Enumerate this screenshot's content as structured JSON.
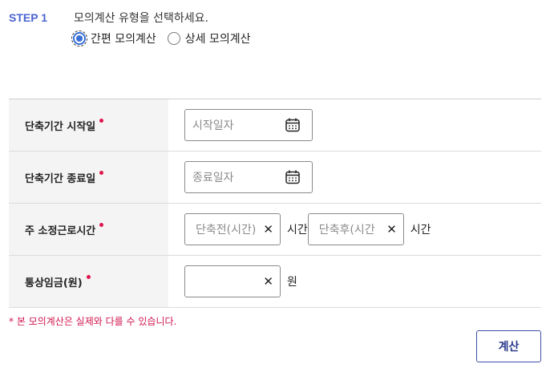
{
  "step": {
    "label": "STEP 1",
    "instruction": "모의계산 유형을 선택하세요."
  },
  "calc_type": {
    "options": [
      {
        "label": "간편 모의계산",
        "selected": true
      },
      {
        "label": "상세 모의계산",
        "selected": false
      }
    ]
  },
  "form": {
    "rows": [
      {
        "label": "단축기간 시작일",
        "required": true,
        "placeholder": "시작일자",
        "icon": "calendar-icon"
      },
      {
        "label": "단축기간 종료일",
        "required": true,
        "placeholder": "종료일자",
        "icon": "calendar-icon"
      },
      {
        "label": "주 소정근로시간",
        "required": true,
        "before_placeholder": "단축전(시간)",
        "before_unit": "시간",
        "after_placeholder": "단축후(시간",
        "after_unit": "시간"
      },
      {
        "label": "통상임금(원)",
        "required": true,
        "value": "",
        "unit": "원"
      }
    ]
  },
  "notice": "* 본 모의계산은 실제와 다를 수 있습니다.",
  "buttons": {
    "calculate": "계산"
  },
  "colors": {
    "accent": "#4a63d0",
    "required": "#e0154c",
    "button_border": "#3d4fa8"
  }
}
